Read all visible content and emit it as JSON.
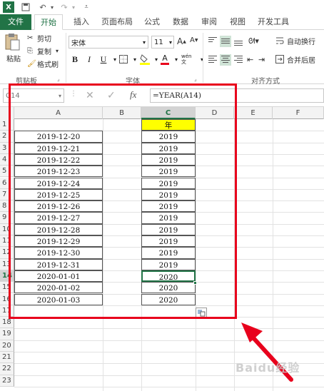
{
  "tabs": [
    "文件",
    "开始",
    "插入",
    "页面布局",
    "公式",
    "数据",
    "审阅",
    "视图",
    "开发工具"
  ],
  "clipboard": {
    "paste": "粘贴",
    "cut": "剪切",
    "copy": "复制",
    "painter": "格式刷",
    "group": "剪贴板"
  },
  "font": {
    "name": "宋体",
    "size": "11",
    "bold": "B",
    "italic": "I",
    "underline": "U",
    "group": "字体",
    "wen": "wén 文"
  },
  "alignment": {
    "wrap": "自动换行",
    "merge": "合并后居",
    "group": "对齐方式"
  },
  "formula_bar": {
    "name_box": "C14",
    "formula": "=YEAR(A14)",
    "fx": "fx"
  },
  "columns": [
    "A",
    "B",
    "C",
    "D",
    "E",
    "F"
  ],
  "rows": [
    "1",
    "2",
    "3",
    "4",
    "5",
    "6",
    "7",
    "8",
    "9",
    "10",
    "11",
    "12",
    "13",
    "14",
    "15",
    "16",
    "17",
    "18",
    "19",
    "20",
    "21",
    "22",
    "23"
  ],
  "header_cell": "年",
  "dates": [
    "2019-12-20",
    "2019-12-21",
    "2019-12-22",
    "2019-12-23",
    "2019-12-24",
    "2019-12-25",
    "2019-12-26",
    "2019-12-27",
    "2019-12-28",
    "2019-12-29",
    "2019-12-30",
    "2019-12-31",
    "2020-01-01",
    "2020-01-02",
    "2020-01-03"
  ],
  "years": [
    "2019",
    "2019",
    "2019",
    "2019",
    "2019",
    "2019",
    "2019",
    "2019",
    "2019",
    "2019",
    "2019",
    "2019",
    "2020",
    "2020",
    "2020"
  ],
  "watermark": "Baidu经验",
  "colors": {
    "accent": "#217346",
    "annotation": "#e8001c",
    "header_fill": "#ffff00"
  }
}
